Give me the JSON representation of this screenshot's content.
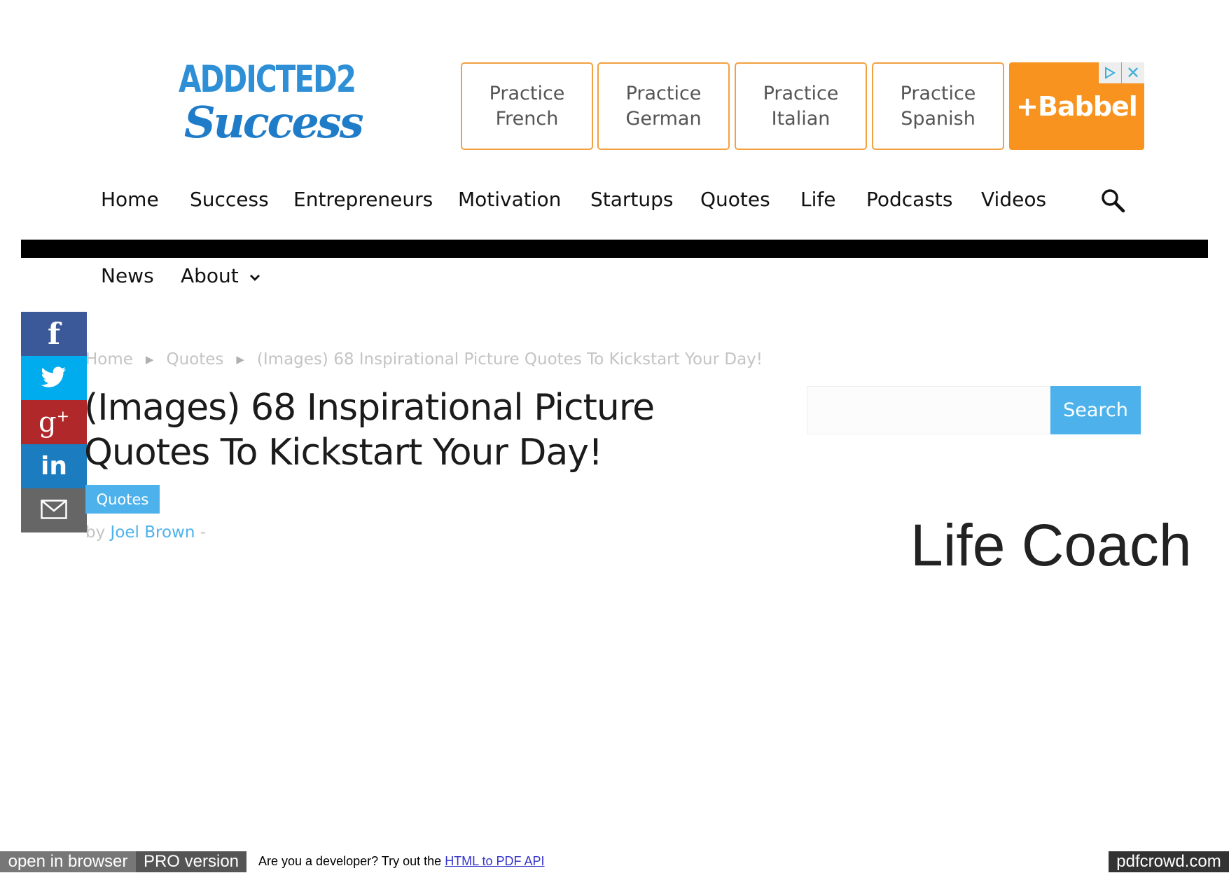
{
  "logo": {
    "line1": "ADDICTED2",
    "line2": "Success"
  },
  "ad": {
    "buttons": [
      "Practice\nFrench",
      "Practice\nGerman",
      "Practice\nItalian",
      "Practice\nSpanish"
    ],
    "brand": "+Babbel",
    "choice_icon": "adchoices-icon",
    "close_glyph": "✕"
  },
  "nav": {
    "items": [
      "Home",
      "Success",
      "Entrepreneurs",
      "Motivation",
      "Startups",
      "Quotes",
      "Life",
      "Podcasts",
      "Videos"
    ],
    "row2": [
      "News",
      "About"
    ]
  },
  "social": [
    "facebook-icon",
    "twitter-icon",
    "google-plus-icon",
    "linkedin-icon",
    "email-icon"
  ],
  "breadcrumb": [
    "Home",
    "Quotes",
    "(Images) 68 Inspirational Picture Quotes To Kickstart Your Day!"
  ],
  "article": {
    "title": "(Images) 68 Inspirational Picture Quotes To Kickstart Your Day!",
    "category": "Quotes",
    "by": "by",
    "author": "Joel Brown",
    "dash": "-"
  },
  "sidebar": {
    "search_button": "Search",
    "search_placeholder": "",
    "ad_text": "Life Coach"
  },
  "pdfcrowd": {
    "open_in_browser": "open in browser",
    "pro_version": "PRO version",
    "dev_text": "Are you a developer? Try out the",
    "api_link": "HTML to PDF API",
    "brand": "pdfcrowd.com"
  },
  "colors": {
    "accent": "#4db2ec",
    "facebook": "#3b5998",
    "twitter": "#00aced",
    "google": "#b0282a",
    "linkedin": "#1c7cc0",
    "email": "#666666",
    "babbel": "#f7931e"
  }
}
